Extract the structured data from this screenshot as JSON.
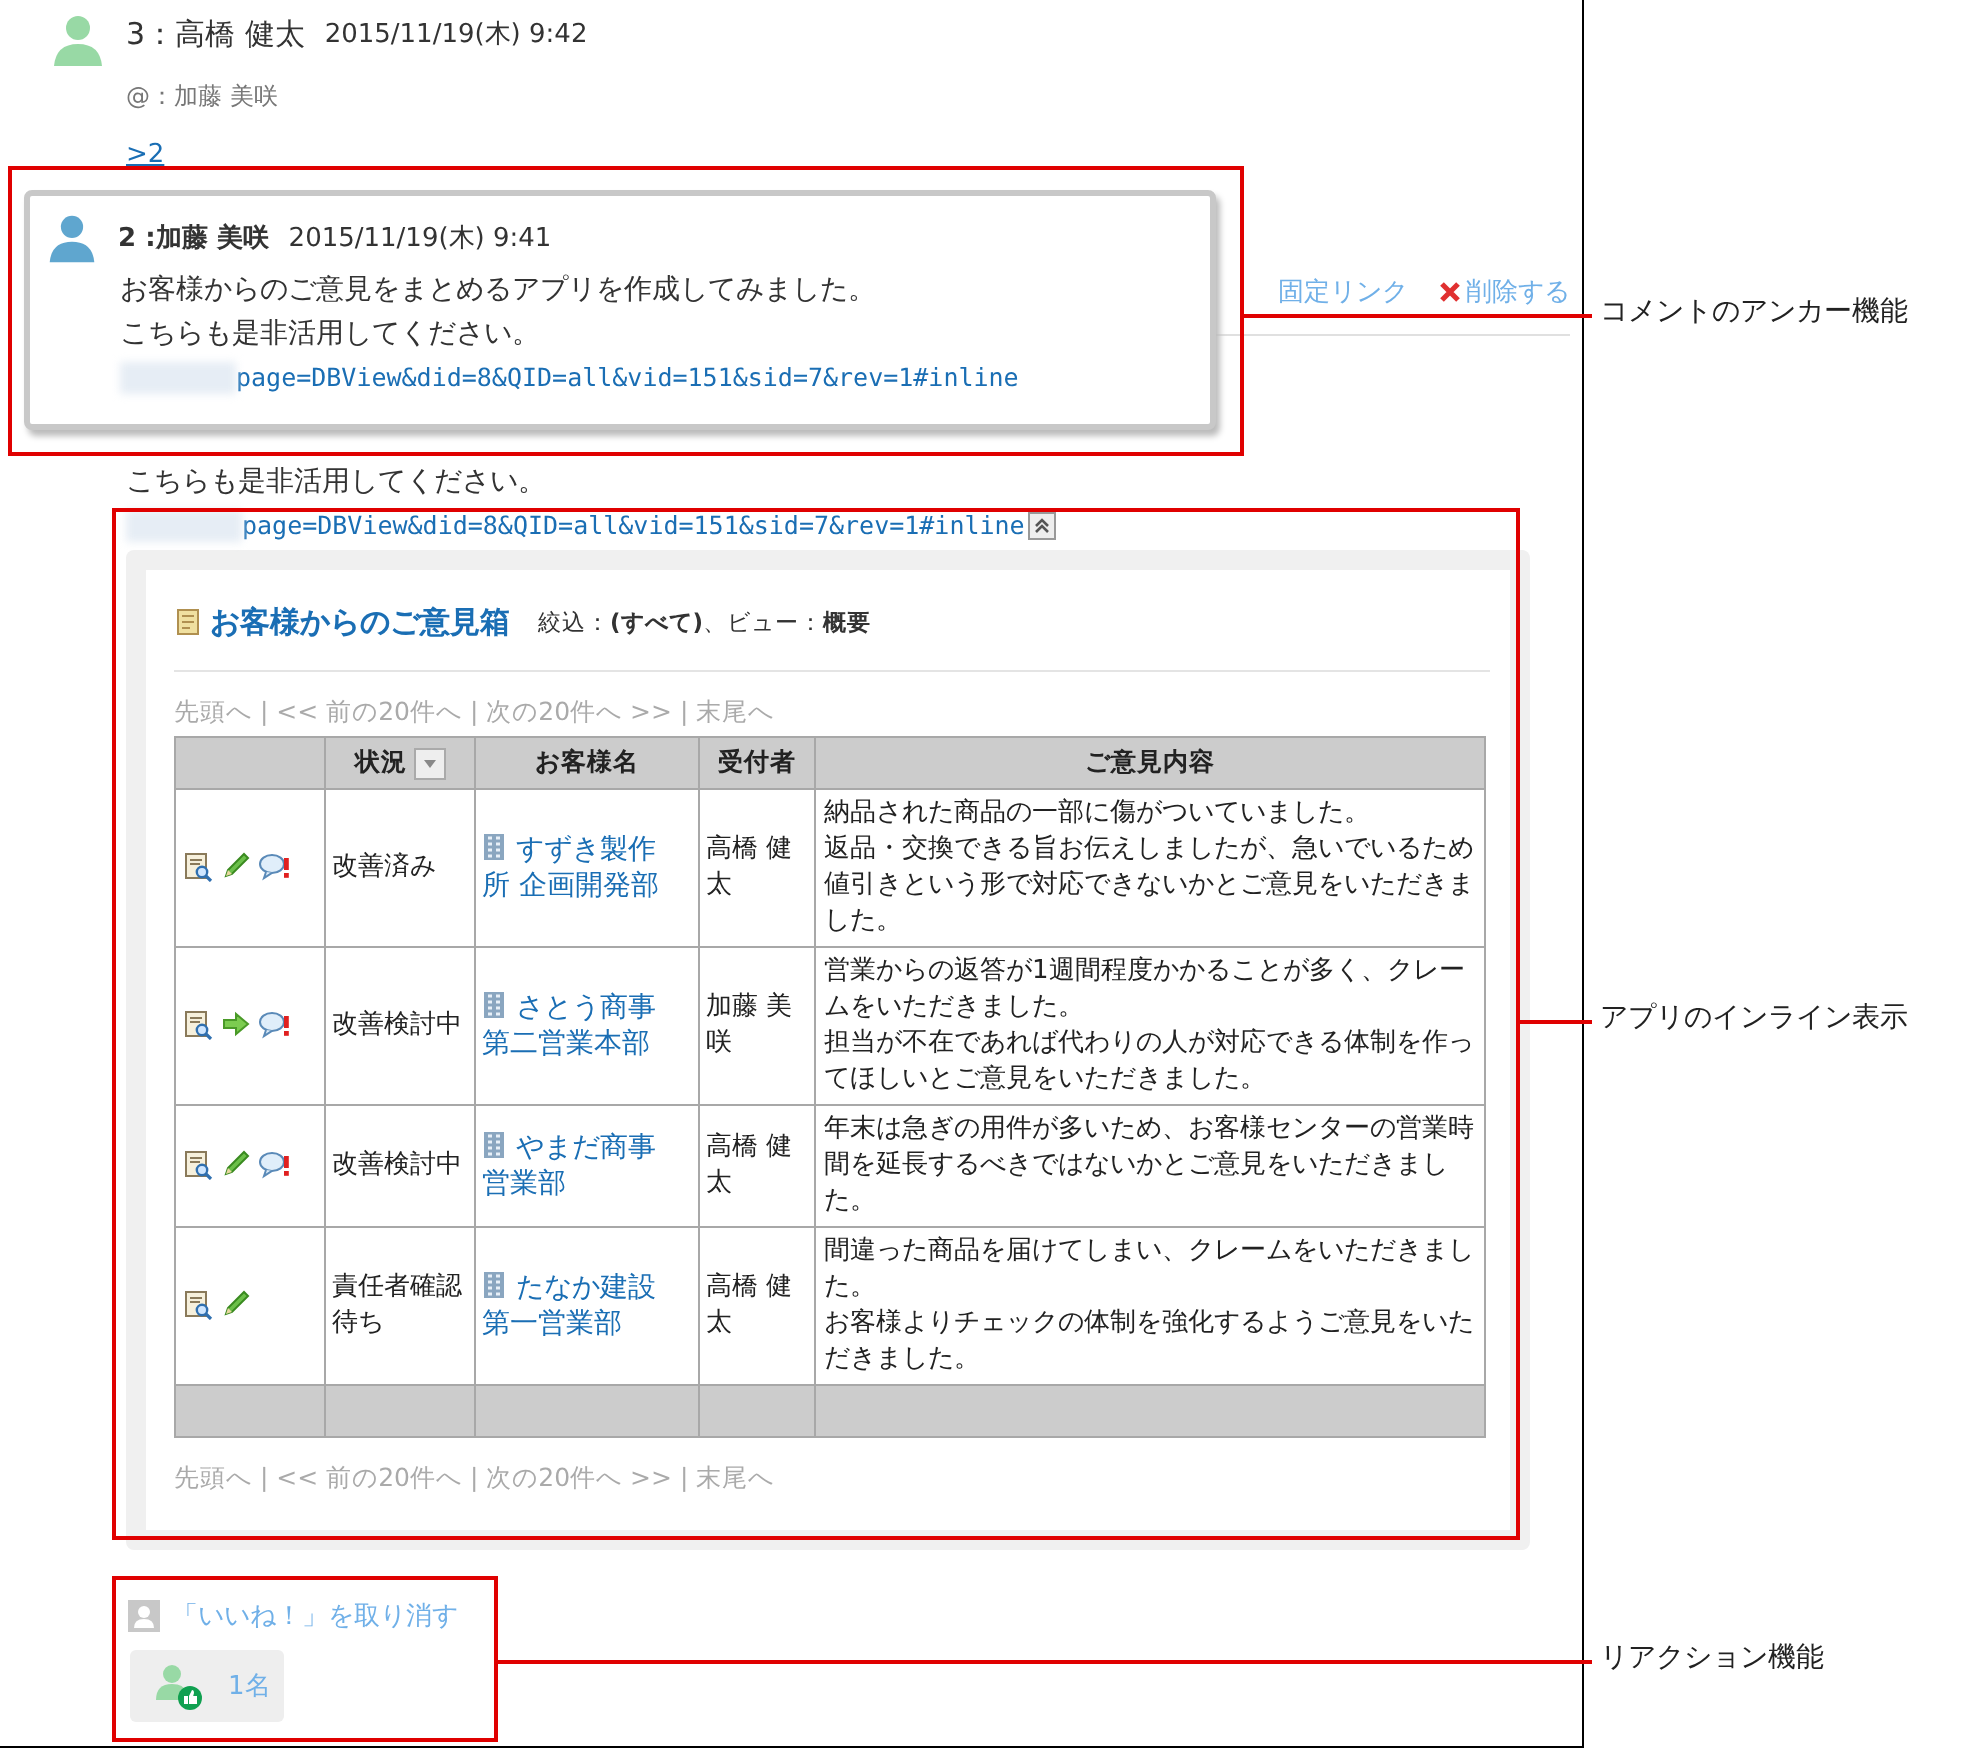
{
  "comment": {
    "header": "3：高橋 健太",
    "date": "2015/11/19(木) 9:42",
    "mention": "@：加藤 美咲",
    "anchor_link": ">2",
    "actions": [
      {
        "kind": "link",
        "label": "固定リンク"
      },
      {
        "kind": "delete",
        "label": "削除する"
      }
    ],
    "body_lines": [
      "こちらも是非活用してください。"
    ],
    "url": "page=DBView&did=8&QID=all&vid=151&sid=7&rev=1#inline"
  },
  "anchor_popup": {
    "header": "2 :加藤 美咲",
    "date": "2015/11/19(木) 9:41",
    "body_lines": [
      "お客様からのご意見をまとめるアプリを作成してみました。",
      "こちらも是非活用してください。"
    ],
    "url": "page=DBView&did=8&QID=all&vid=151&sid=7&rev=1#inline"
  },
  "inline_app": {
    "title": "お客様からのご意見箱",
    "filter_label": "絞込：",
    "filter_value": "(すべて)",
    "view_label": "、ビュー：",
    "view_value": "概要",
    "pager_top": "先頭へ | << 前の20件へ | 次の20件へ >> | 末尾へ",
    "columns": [
      {
        "label": "状況",
        "sortable": true
      },
      {
        "label": "お客様名",
        "sortable": false
      },
      {
        "label": "受付者",
        "sortable": false
      },
      {
        "label": "ご意見内容",
        "sortable": false
      }
    ],
    "rows": [
      {
        "actions": [
          {
            "kind": "view"
          },
          {
            "kind": "edit"
          },
          {
            "kind": "comment"
          }
        ],
        "status": "改善済み",
        "customer_lines": [
          "すずき製作所 企画開発部"
        ],
        "assignee": "高橋 健太",
        "content_lines": [
          "納品された商品の一部に傷がついていました。",
          "返品・交換できる旨お伝えしましたが、急いでいるため",
          "値引きという形で対応できないかとご意見をいただきました。"
        ]
      },
      {
        "actions": [
          {
            "kind": "view"
          },
          {
            "kind": "proceed"
          },
          {
            "kind": "comment"
          }
        ],
        "status": "改善検討中",
        "customer_lines": [
          "さとう商事",
          "第二営業本部"
        ],
        "assignee": "加藤 美咲",
        "content_lines": [
          "営業からの返答が1週間程度かかることが多く、クレームをいただきました。",
          "担当が不在であれば代わりの人が対応できる体制を作ってほしいとご意見をいただきました。"
        ]
      },
      {
        "actions": [
          {
            "kind": "view"
          },
          {
            "kind": "edit"
          },
          {
            "kind": "comment"
          }
        ],
        "status": "改善検討中",
        "customer_lines": [
          "やまだ商事",
          "営業部"
        ],
        "assignee": "高橋 健太",
        "content_lines": [
          "年末は急ぎの用件が多いため、お客様センターの営業時間を延長するべきではないかとご意見をいただきました。"
        ]
      },
      {
        "actions": [
          {
            "kind": "view"
          },
          {
            "kind": "edit"
          }
        ],
        "status": "責任者確認待ち",
        "customer_lines": [
          "たなか建設",
          "第一営業部"
        ],
        "assignee": "高橋 健太",
        "content_lines": [
          "間違った商品を届けてしまい、クレームをいただきました。",
          "お客様よりチェックの体制を強化するようご意見をいただきました。"
        ]
      }
    ],
    "pager_bottom": "先頭へ | << 前の20件へ | 次の20件へ >> | 末尾へ"
  },
  "reaction": {
    "undo_label": "「いいね！」を取り消す",
    "count": "1名"
  },
  "annotations": [
    {
      "label": "コメントのアンカー機能"
    },
    {
      "label": "アプリのインライン表示"
    },
    {
      "label": "リアクション機能"
    }
  ]
}
